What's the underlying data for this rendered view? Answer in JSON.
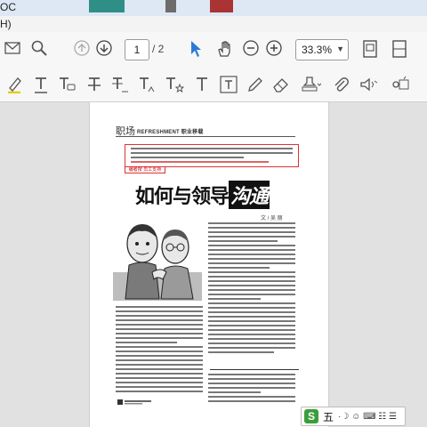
{
  "window": {
    "title_fragment": "OC"
  },
  "menubar": {
    "fragment": "H)"
  },
  "toolbar": {
    "page_current": "1",
    "page_total": "/ 2",
    "zoom": "33.3%",
    "zoom_caret": "▼"
  },
  "document": {
    "section": "职场",
    "section_en": "REFRESHMENT 职业移载",
    "intro_label": "编者按 员工支持",
    "headline_prefix": "如何与领导",
    "headline_box": "沟通",
    "byline": "文 / 吴 丽"
  },
  "ime": {
    "logo": "S",
    "mode": "五",
    "glyphs": "·☽ ☺ ⌨ ☷ ☰"
  }
}
